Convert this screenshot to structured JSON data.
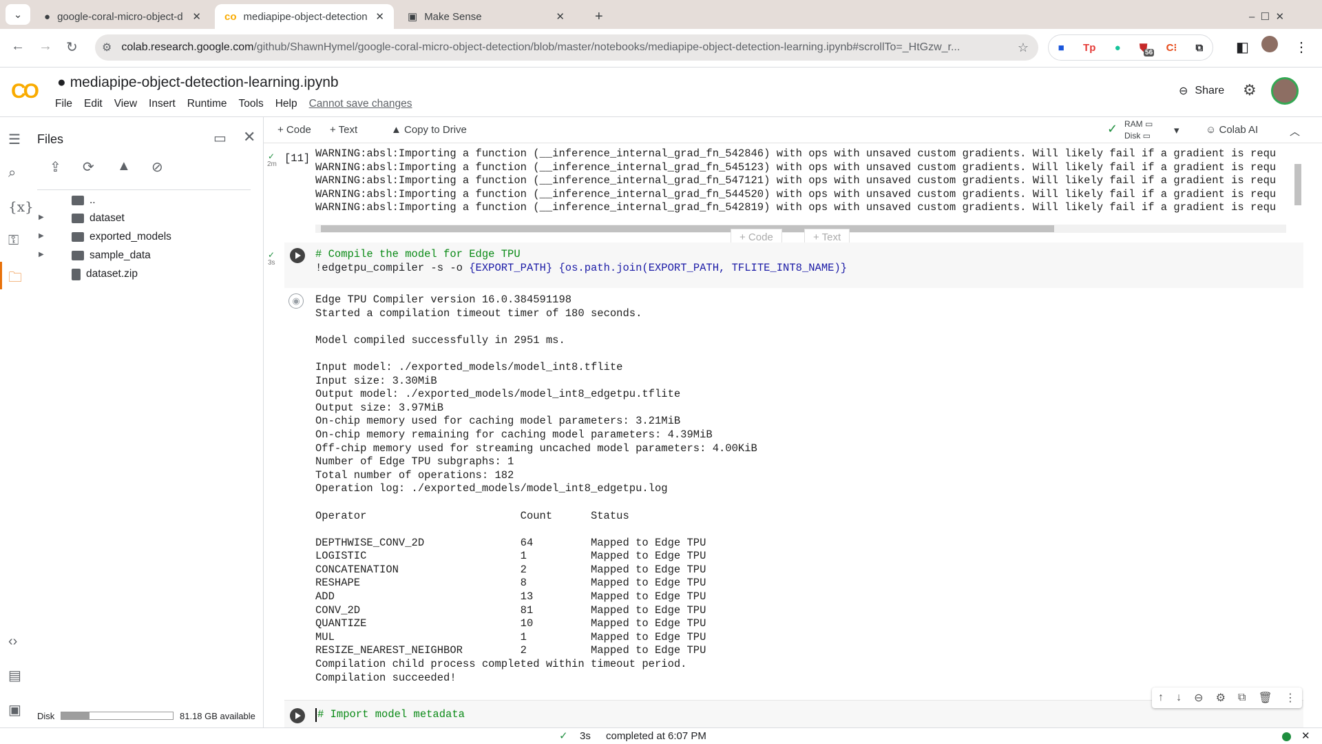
{
  "browser": {
    "tabs": [
      {
        "label": "google-coral-micro-object-d",
        "icon": "github-icon"
      },
      {
        "label": "mediapipe-object-detection",
        "icon": "colab-icon",
        "active": true
      },
      {
        "label": "Make Sense",
        "icon": "makesense-icon"
      }
    ],
    "url_host": "colab.research.google.com",
    "url_path": "/github/ShawnHymel/google-coral-micro-object-detection/blob/master/notebooks/mediapipe-object-detection-learning.ipynb#scrollTo=_HtGzw_r...",
    "extension_badge": "56"
  },
  "header": {
    "logo": "CO",
    "title": "mediapipe-object-detection-learning.ipynb",
    "menu": [
      "File",
      "Edit",
      "View",
      "Insert",
      "Runtime",
      "Tools",
      "Help"
    ],
    "cannot_save": "Cannot save changes",
    "share": "Share"
  },
  "toolbar": {
    "code": "+ Code",
    "text": "+ Text",
    "copy": "Copy to Drive",
    "ram": "RAM",
    "disk": "Disk",
    "colab_ai": "Colab AI"
  },
  "files": {
    "title": "Files",
    "items": [
      {
        "name": ".."
      },
      {
        "name": "dataset",
        "folder": true
      },
      {
        "name": "exported_models",
        "folder": true
      },
      {
        "name": "sample_data",
        "folder": true
      },
      {
        "name": "dataset.zip"
      }
    ],
    "disk_label": "Disk",
    "disk_available": "81.18 GB available",
    "disk_used_fraction": 0.25
  },
  "cell11": {
    "exec": "[11]",
    "time": "2m",
    "lines": [
      "WARNING:absl:Importing a function (__inference_internal_grad_fn_542846) with ops with unsaved custom gradients. Will likely fail if a gradient is requ",
      "WARNING:absl:Importing a function (__inference_internal_grad_fn_545123) with ops with unsaved custom gradients. Will likely fail if a gradient is requ",
      "WARNING:absl:Importing a function (__inference_internal_grad_fn_547121) with ops with unsaved custom gradients. Will likely fail if a gradient is requ",
      "WARNING:absl:Importing a function (__inference_internal_grad_fn_544520) with ops with unsaved custom gradients. Will likely fail if a gradient is requ",
      "WARNING:absl:Importing a function (__inference_internal_grad_fn_542819) with ops with unsaved custom gradients. Will likely fail if a gradient is requ"
    ]
  },
  "add_code": "+ Code",
  "add_text": "+ Text",
  "compile_cell": {
    "time": "3s",
    "comment": "# Compile the model for Edge TPU",
    "cmd_a": "!edgetpu_compiler -s -o ",
    "cmd_b": "{EXPORT_PATH}",
    "cmd_c": " ",
    "cmd_d": "{os.path.join(EXPORT_PATH, TFLITE_INT8_NAME)}",
    "output_before": [
      "Edge TPU Compiler version 16.0.384591198",
      "Started a compilation timeout timer of 180 seconds.",
      "",
      "Model compiled successfully in 2951 ms.",
      "",
      "Input model: ./exported_models/model_int8.tflite",
      "Input size: 3.30MiB",
      "Output model: ./exported_models/model_int8_edgetpu.tflite",
      "Output size: 3.97MiB",
      "On-chip memory used for caching model parameters: 3.21MiB",
      "On-chip memory remaining for caching model parameters: 4.39MiB",
      "Off-chip memory used for streaming uncached model parameters: 4.00KiB",
      "Number of Edge TPU subgraphs: 1",
      "Total number of operations: 182",
      "Operation log: ./exported_models/model_int8_edgetpu.log",
      ""
    ],
    "table_header": [
      "Operator",
      "Count",
      "Status"
    ],
    "table_rows": [
      [
        "DEPTHWISE_CONV_2D",
        "64",
        "Mapped to Edge TPU"
      ],
      [
        "LOGISTIC",
        "1",
        "Mapped to Edge TPU"
      ],
      [
        "CONCATENATION",
        "2",
        "Mapped to Edge TPU"
      ],
      [
        "RESHAPE",
        "8",
        "Mapped to Edge TPU"
      ],
      [
        "ADD",
        "13",
        "Mapped to Edge TPU"
      ],
      [
        "CONV_2D",
        "81",
        "Mapped to Edge TPU"
      ],
      [
        "QUANTIZE",
        "10",
        "Mapped to Edge TPU"
      ],
      [
        "MUL",
        "1",
        "Mapped to Edge TPU"
      ],
      [
        "RESIZE_NEAREST_NEIGHBOR",
        "2",
        "Mapped to Edge TPU"
      ]
    ],
    "output_after": [
      "Compilation child process completed within timeout period.",
      "Compilation succeeded!"
    ]
  },
  "next_cell": {
    "code": "# Import model metadata"
  },
  "status": {
    "time": "3s",
    "text": "completed at 6:07 PM"
  },
  "colors": {
    "accent": "#f9ab00",
    "comment": "#0a8a16",
    "ok": "#1e8e3e"
  }
}
